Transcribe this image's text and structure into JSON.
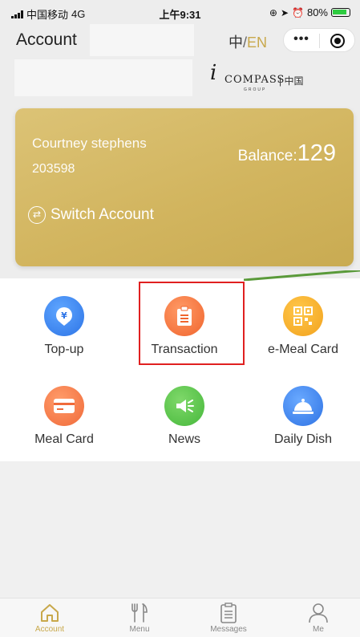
{
  "status_bar": {
    "carrier": "中国移动",
    "network": "4G",
    "time": "上午9:31",
    "battery": "80%"
  },
  "header": {
    "title": "Account",
    "lang_zh": "中",
    "lang_sep": "/",
    "lang_en": "EN",
    "more_glyph": "•••"
  },
  "logo": {
    "mark": "i",
    "word": "COMPASS",
    "group": "GROUP",
    "cn": "| 中国"
  },
  "card": {
    "name": "Courtney stephens",
    "number": "203598",
    "balance_label": "Balance:",
    "balance_value": "129",
    "switch_label": "Switch Account"
  },
  "menu": [
    {
      "label": "Top-up",
      "icon": "yuan-shield-icon",
      "color": "#2d74e6"
    },
    {
      "label": "Transaction",
      "icon": "clipboard-icon",
      "color": "#f0652e"
    },
    {
      "label": "e-Meal Card",
      "icon": "qr-code-icon",
      "color": "#f2a21e"
    },
    {
      "label": "Meal Card",
      "icon": "card-icon",
      "color": "#f06a3a"
    },
    {
      "label": "News",
      "icon": "megaphone-icon",
      "color": "#46b83b"
    },
    {
      "label": "Daily Dish",
      "icon": "cloche-icon",
      "color": "#2f73e4"
    }
  ],
  "tabbar": {
    "items": [
      {
        "label": "Account",
        "icon": "home-icon",
        "active": true
      },
      {
        "label": "Menu",
        "icon": "fork-knife-icon",
        "active": false
      },
      {
        "label": "Messages",
        "icon": "clipboard-list-icon",
        "active": false
      },
      {
        "label": "Me",
        "icon": "person-icon",
        "active": false
      }
    ]
  },
  "colors": {
    "accent": "#c8a84b",
    "highlight_box": "#e02020",
    "pointer_line": "#5a9a3a"
  }
}
